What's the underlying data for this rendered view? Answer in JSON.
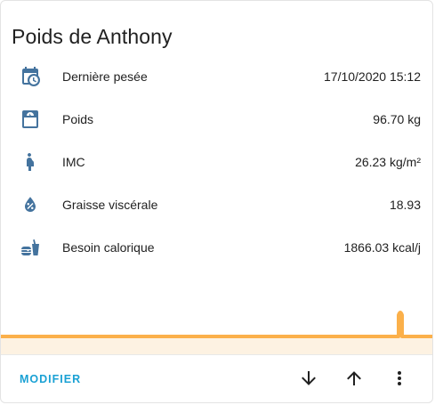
{
  "card": {
    "title": "Poids de Anthony"
  },
  "entities": [
    {
      "icon": "calendar-clock-icon",
      "name": "Dernière pesée",
      "value": "17/10/2020 15:12"
    },
    {
      "icon": "scale-bathroom-icon",
      "name": "Poids",
      "value": "96.70 kg"
    },
    {
      "icon": "human-pregnant-icon",
      "name": "IMC",
      "value": "26.23 kg/m²"
    },
    {
      "icon": "water-percent-icon",
      "name": "Graisse viscérale",
      "value": "18.93"
    },
    {
      "icon": "food-icon",
      "name": "Besoin calorique",
      "value": "1866.03 kcal/j"
    }
  ],
  "actions": {
    "modify_label": "MODIFIER",
    "down_icon": "arrow-down-icon",
    "up_icon": "arrow-up-icon",
    "menu_icon": "dots-vertical-icon"
  },
  "colors": {
    "icon": "#44739e",
    "graph_line": "#fbb04a",
    "graph_fill": "#fdf2e2",
    "accent": "#1aa1d4",
    "text": "#212121"
  }
}
